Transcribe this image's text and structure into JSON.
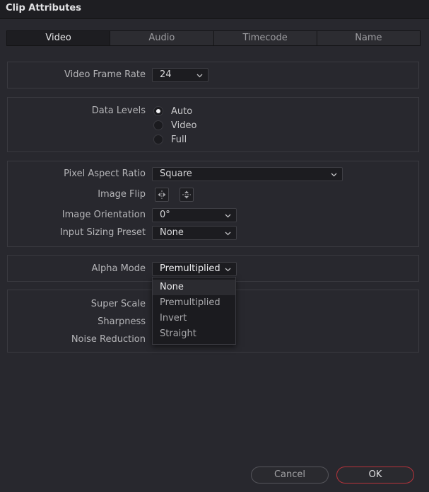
{
  "window": {
    "title": "Clip Attributes"
  },
  "tabs": [
    {
      "label": "Video",
      "active": true
    },
    {
      "label": "Audio",
      "active": false
    },
    {
      "label": "Timecode",
      "active": false
    },
    {
      "label": "Name",
      "active": false
    }
  ],
  "frame_rate": {
    "label": "Video Frame Rate",
    "value": "24"
  },
  "data_levels": {
    "label": "Data Levels",
    "options": [
      {
        "label": "Auto",
        "checked": true
      },
      {
        "label": "Video",
        "checked": false
      },
      {
        "label": "Full",
        "checked": false
      }
    ]
  },
  "image": {
    "pixel_aspect_label": "Pixel Aspect Ratio",
    "pixel_aspect_value": "Square",
    "image_flip_label": "Image Flip",
    "orientation_label": "Image Orientation",
    "orientation_value": "0°",
    "sizing_label": "Input Sizing Preset",
    "sizing_value": "None"
  },
  "alpha": {
    "label": "Alpha Mode",
    "value": "Premultiplied",
    "menu_options": [
      "None",
      "Premultiplied",
      "Invert",
      "Straight"
    ],
    "highlighted": "None"
  },
  "enhance": {
    "super_scale_label": "Super Scale",
    "sharpness_label": "Sharpness",
    "noise_label": "Noise Reduction"
  },
  "buttons": {
    "cancel": "Cancel",
    "ok": "OK"
  },
  "colors": {
    "background": "#28282e",
    "ok_border": "#b8333b",
    "dropdown_bg": "#1c1c20"
  }
}
